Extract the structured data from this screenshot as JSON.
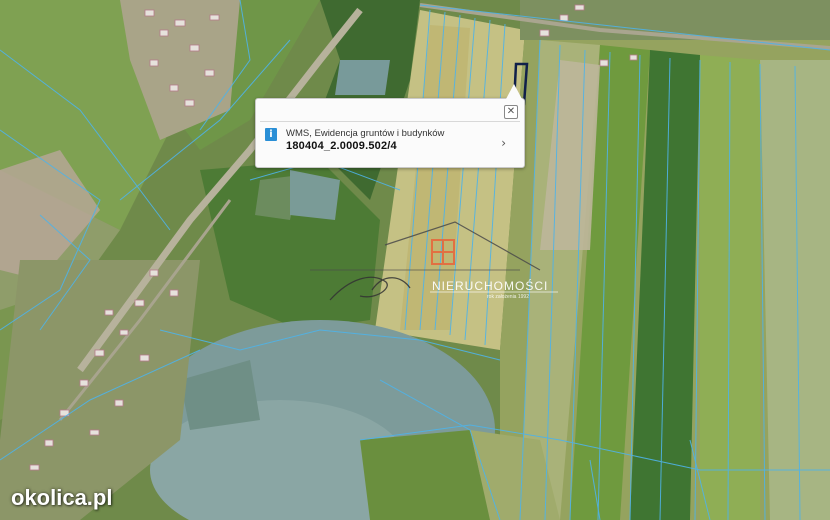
{
  "popup": {
    "layer_name": "WMS, Ewidencja gruntów i budynków",
    "parcel_id": "180404_2.0009.502/4",
    "close_glyph": "✕",
    "next_glyph": "›",
    "info_glyph": "i"
  },
  "watermark": {
    "brand": "NIERUCHOMOŚCI",
    "since": "rok założenia 1992"
  },
  "site_logo": "okolica.pl",
  "colors": {
    "parcel_lines": "#4fb3e8",
    "selected_parcel": "#10204a",
    "popup_bg": "#fbfbfb",
    "info_icon": "#2a8fd6",
    "watermark_logo": "#e8643a"
  }
}
